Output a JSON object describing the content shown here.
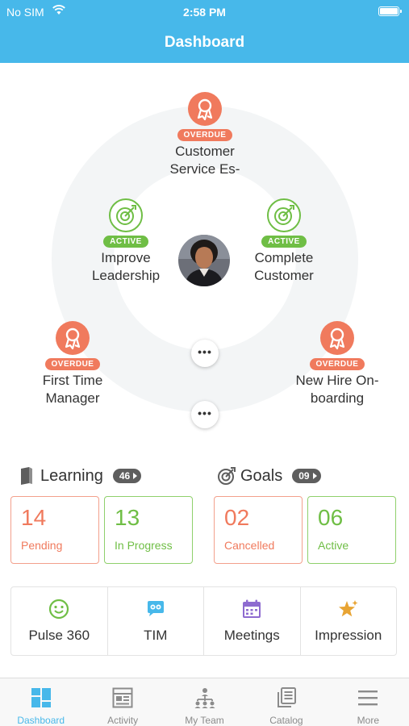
{
  "status_bar": {
    "carrier": "No SIM",
    "time": "2:58 PM"
  },
  "header": {
    "title": "Dashboard"
  },
  "wheel": {
    "nodes": [
      {
        "label": "Customer Service Es-",
        "badge": "OVERDUE",
        "icon": "award-icon"
      },
      {
        "label": "Improve Leadership",
        "badge": "ACTIVE",
        "icon": "target-icon"
      },
      {
        "label": "Complete Customer",
        "badge": "ACTIVE",
        "icon": "target-icon"
      },
      {
        "label": "First Time Manager",
        "badge": "OVERDUE",
        "icon": "award-icon"
      },
      {
        "label": "New Hire On-boarding",
        "badge": "OVERDUE",
        "icon": "award-icon"
      }
    ],
    "more_inner": "•••",
    "more_outer": "•••"
  },
  "learning": {
    "title": "Learning",
    "count": "46",
    "stats": [
      {
        "value": "14",
        "label": "Pending"
      },
      {
        "value": "13",
        "label": "In Progress"
      }
    ]
  },
  "goals": {
    "title": "Goals",
    "count": "09",
    "stats": [
      {
        "value": "02",
        "label": "Cancelled"
      },
      {
        "value": "06",
        "label": "Active"
      }
    ]
  },
  "quick_actions": [
    {
      "label": "Pulse 360",
      "icon": "smiley-icon"
    },
    {
      "label": "TIM",
      "icon": "chat-bot-icon"
    },
    {
      "label": "Meetings",
      "icon": "calendar-icon"
    },
    {
      "label": "Impression",
      "icon": "star-icon"
    }
  ],
  "tabs": [
    {
      "label": "Dashboard",
      "icon": "dashboard-icon",
      "active": true
    },
    {
      "label": "Activity",
      "icon": "activity-icon"
    },
    {
      "label": "My Team",
      "icon": "team-icon"
    },
    {
      "label": "Catalog",
      "icon": "catalog-icon"
    },
    {
      "label": "More",
      "icon": "menu-icon"
    }
  ],
  "colors": {
    "brand": "#47b8ea",
    "overdue": "#f07a5d",
    "active": "#6fbe45"
  }
}
